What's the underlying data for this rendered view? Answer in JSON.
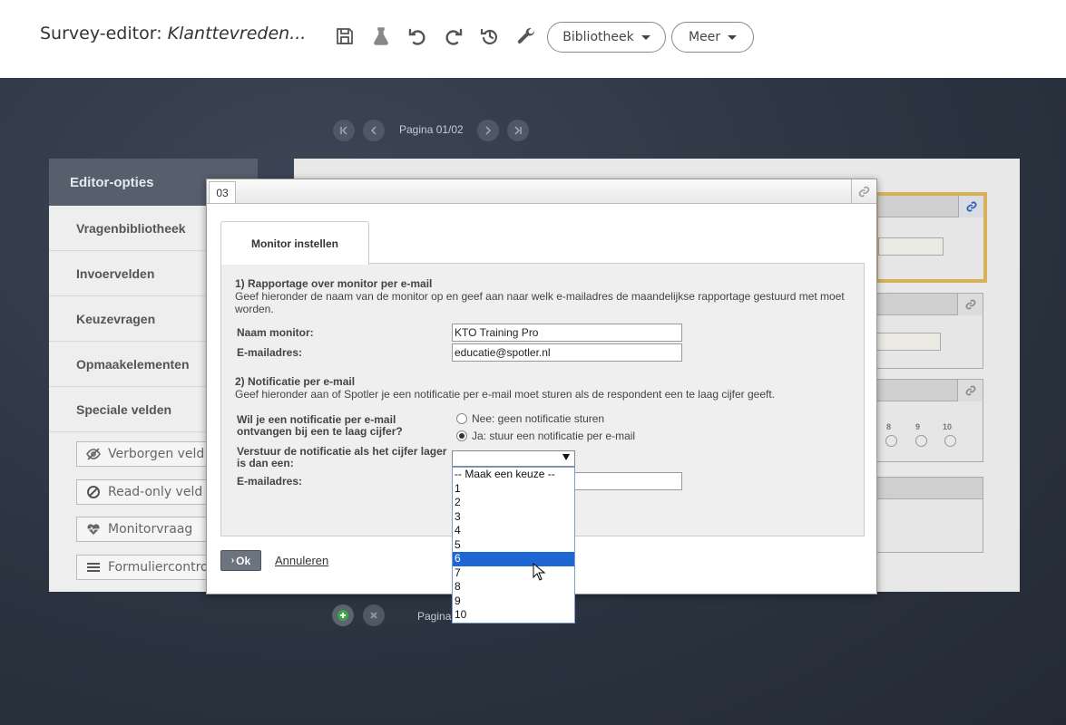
{
  "header": {
    "title_prefix": "Survey-editor: ",
    "survey_name": "Klanttevreden...",
    "icons": [
      "save-icon",
      "flask-icon",
      "undo-icon",
      "redo-icon",
      "history-icon",
      "wrench-icon"
    ],
    "library_button": "Bibliotheek",
    "more_button": "Meer"
  },
  "pager": {
    "top_label": "Pagina 01/02",
    "bottom_label": "Pagina"
  },
  "editor": {
    "title": "Editor-opties",
    "items": [
      "Vragenbibliotheek",
      "Invoervelden",
      "Keuzevragen",
      "Opmaakelementen",
      "Speciale velden"
    ],
    "tools": [
      {
        "label": "Verborgen veld",
        "icon": "eye-slash-icon"
      },
      {
        "label": "Read-only veld",
        "icon": "ban-icon"
      },
      {
        "label": "Monitorvraag",
        "icon": "heartbeat-icon"
      },
      {
        "label": "Formuliercontrole",
        "icon": "list-icon"
      }
    ]
  },
  "background_survey": {
    "scale_labels": [
      "8",
      "9",
      "10"
    ]
  },
  "modal": {
    "id": "03",
    "tab": "Monitor instellen",
    "section1": {
      "heading": "1) Rapportage over monitor per e-mail",
      "text": "Geef hieronder de naam van de monitor op en geef aan naar welk e-mailadres de maandelijkse rapportage gestuurd met moet worden.",
      "name_label": "Naam monitor:",
      "name_value": "KTO Training Pro",
      "email_label": "E-mailadres:",
      "email_value": "educatie@spotler.nl"
    },
    "section2": {
      "heading": "2) Notificatie per e-mail",
      "text": "Geef hieronder aan of Spotler je een notificatie per e-mail moet sturen als de respondent een te laag cijfer geeft.",
      "question_line1": "Wil je een notificatie per e-mail",
      "question_line2": "ontvangen bij een te laag cijfer?",
      "option_no": "Nee: geen notificatie sturen",
      "option_yes": "Ja: stuur een notificatie per e-mail",
      "threshold_line1": "Verstuur de notificatie als het cijfer lager",
      "threshold_line2": "is dan een:",
      "email_label": "E-mailadres:",
      "dropdown_options": [
        "-- Maak een keuze --",
        "1",
        "2",
        "3",
        "4",
        "5",
        "6",
        "7",
        "8",
        "9",
        "10"
      ],
      "highlighted_option": "6"
    },
    "ok_button": "Ok",
    "cancel_link": "Annuleren"
  }
}
